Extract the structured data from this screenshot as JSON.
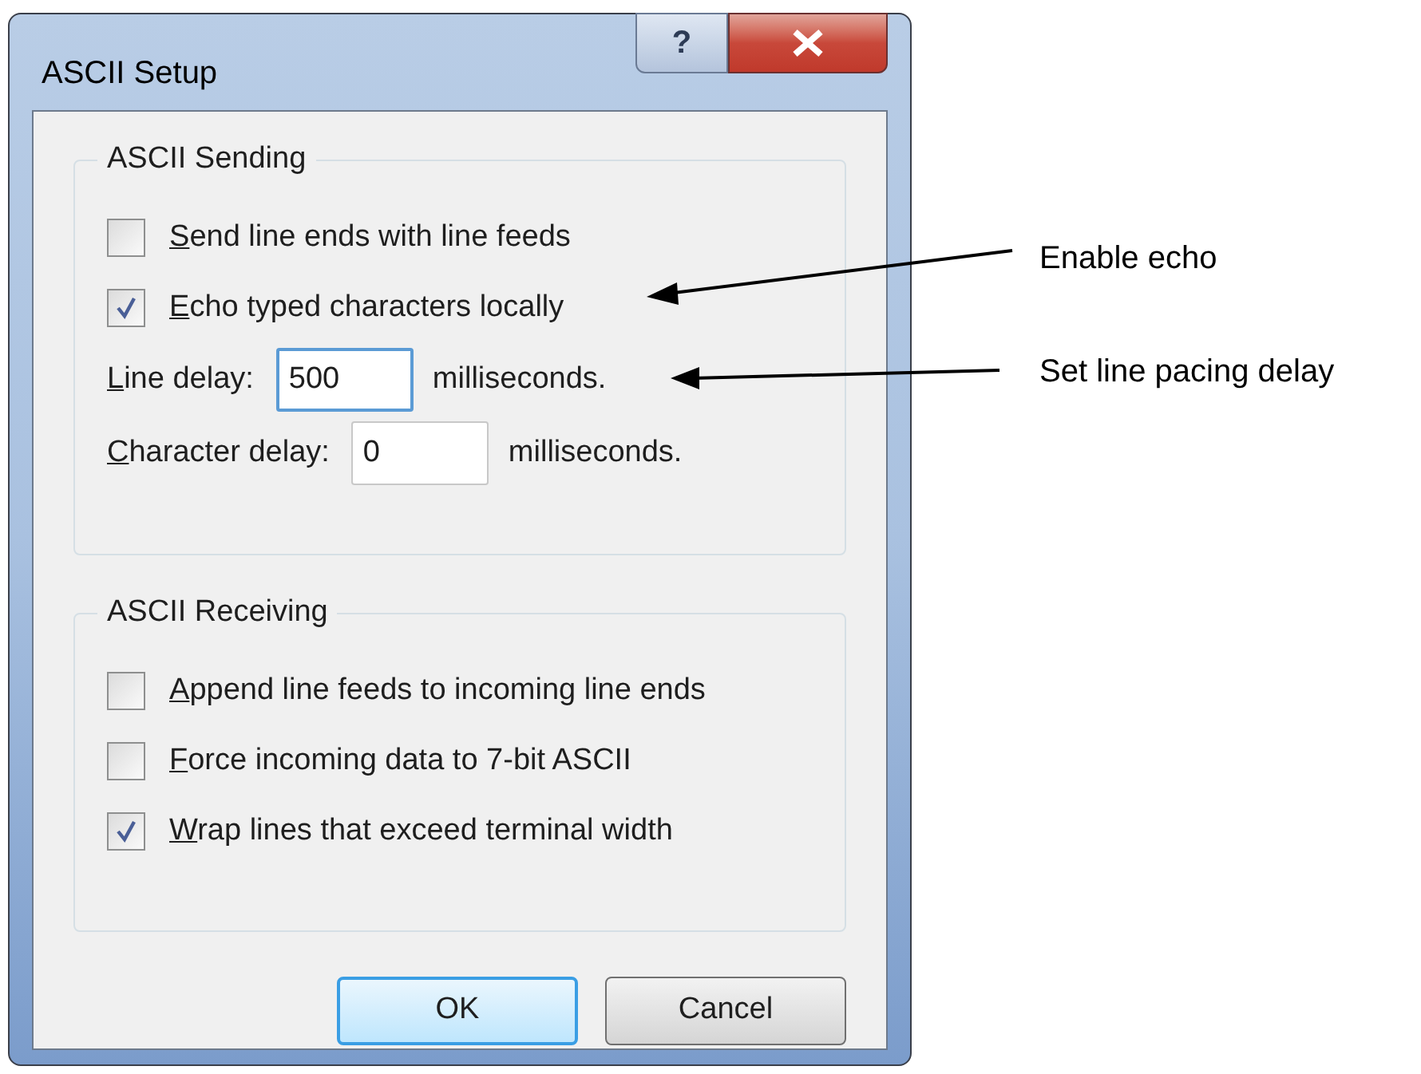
{
  "window": {
    "title": "ASCII Setup",
    "help_button": "?"
  },
  "groups": [
    {
      "title": "ASCII Sending",
      "items": [
        {
          "kind": "checkbox",
          "label": "Send line ends with line feeds",
          "checked": false
        },
        {
          "kind": "checkbox",
          "label": "Echo typed characters locally",
          "checked": true
        },
        {
          "kind": "field",
          "label": "Line delay:",
          "value": "500",
          "unit": "milliseconds.",
          "focused": true
        },
        {
          "kind": "field",
          "label": "Character delay:",
          "value": "0",
          "unit": "milliseconds.",
          "focused": false
        }
      ]
    },
    {
      "title": "ASCII Receiving",
      "items": [
        {
          "kind": "checkbox",
          "label": "Append line feeds to incoming line ends",
          "checked": false
        },
        {
          "kind": "checkbox",
          "label": "Force incoming data to 7-bit ASCII",
          "checked": false
        },
        {
          "kind": "checkbox",
          "label": "Wrap lines that exceed terminal width",
          "checked": true
        }
      ]
    }
  ],
  "buttons": [
    {
      "label": "OK",
      "default": true
    },
    {
      "label": "Cancel",
      "default": false
    }
  ],
  "annotations": [
    "Enable echo",
    "Set line pacing delay"
  ]
}
